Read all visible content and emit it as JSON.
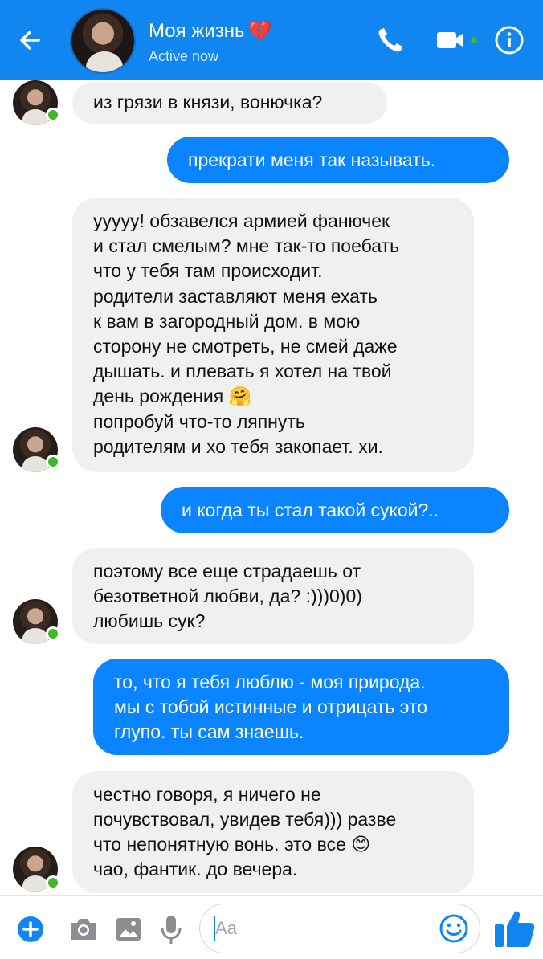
{
  "header": {
    "title": "Моя жизнь",
    "title_emoji": "💔",
    "status": "Active now",
    "icons": [
      "back-arrow-icon",
      "phone-icon",
      "video-camera-icon",
      "info-icon"
    ]
  },
  "messages": [
    {
      "side": "incoming",
      "text": "из грязи в князи, вонючка?"
    },
    {
      "side": "outgoing",
      "text": "прекрати меня так называть."
    },
    {
      "side": "incoming",
      "text": "ууууу! обзавелся армией фанючек\nи стал смелым? мне так-то поебать\nчто у тебя там происходит.\nродители заставляют меня ехать\nк вам в загородный дом. в мою\nсторону не смотреть, не смей даже\nдышать. и плевать я хотел на твой\nдень рождения 🤗\nпопробуй что-то ляпнуть\nродителям и хо тебя закопает. хи."
    },
    {
      "side": "outgoing",
      "text": "и когда ты стал такой сукой?.."
    },
    {
      "side": "incoming",
      "text": "поэтому все еще страдаешь от\nбезответной любви, да? :)))0)0)\nлюбишь сук?"
    },
    {
      "side": "outgoing",
      "text": "то, что я тебя люблю - моя природа.\nмы с тобой истинные и отрицать это\nглупо. ты сам знаешь."
    },
    {
      "side": "incoming",
      "text": "честно говоря, я ничего не\nпочувствовал, увидев тебя))) разве\nчто непонятную вонь. это все 😊\nчао, фантик. до вечера."
    }
  ],
  "composer": {
    "placeholder": "Aa",
    "icons": [
      "plus-icon",
      "camera-icon",
      "gallery-icon",
      "microphone-icon",
      "emoji-icon",
      "like-icon"
    ]
  },
  "colors": {
    "header_bg": "#1186f0",
    "outgoing_bubble": "#0a84ff",
    "incoming_bubble": "#f1f0f0",
    "online_dot": "#42b72a"
  }
}
